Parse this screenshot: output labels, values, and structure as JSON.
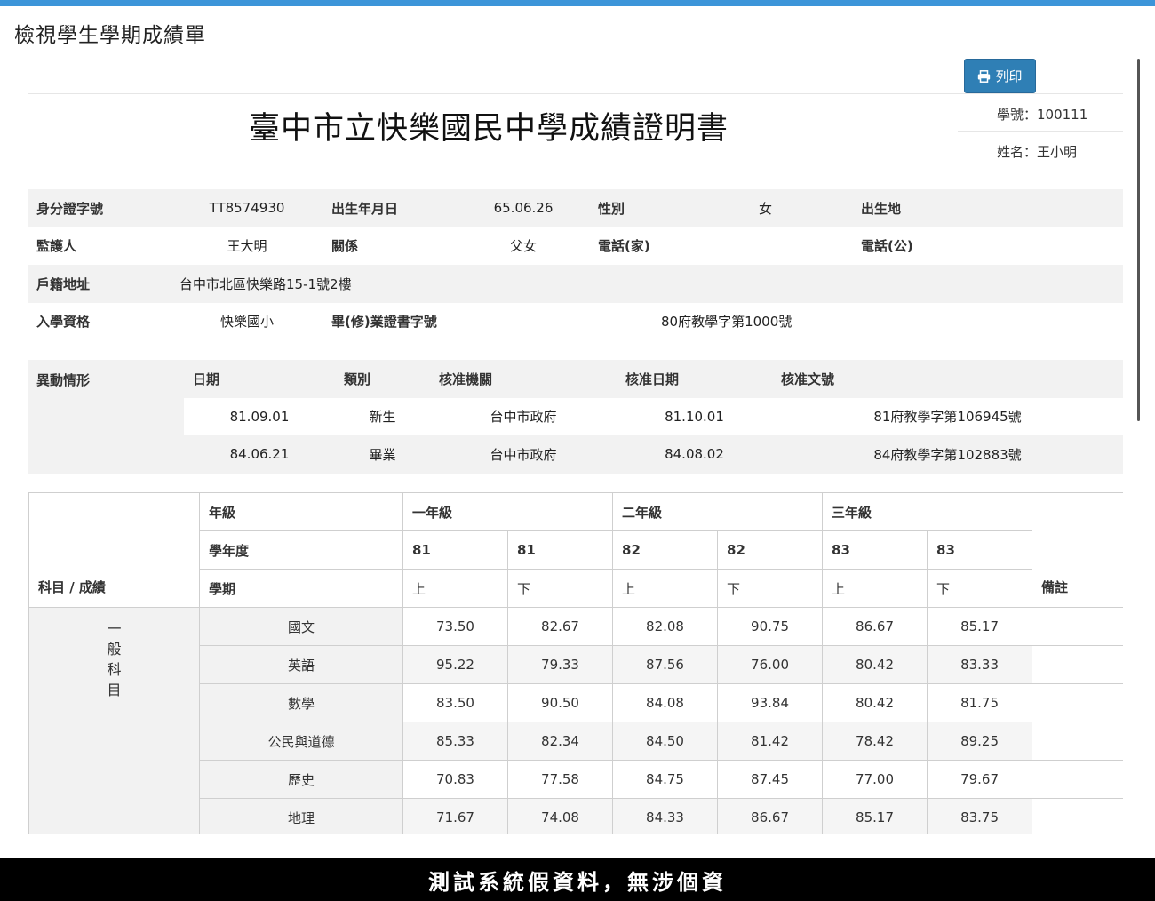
{
  "page": {
    "title": "檢視學生學期成績單"
  },
  "toolbar": {
    "print_label": "列印"
  },
  "certificate": {
    "title": "臺中市立快樂國民中學成績證明書",
    "student_id_label": "學號：100111",
    "name_label": "姓名：王小明"
  },
  "info": {
    "id_label": "身分證字號",
    "id_value": "TT8574930",
    "birth_label": "出生年月日",
    "birth_value": "65.06.26",
    "gender_label": "性別",
    "gender_value": "女",
    "birthplace_label": "出生地",
    "birthplace_value": "",
    "guardian_label": "監護人",
    "guardian_value": "王大明",
    "relation_label": "關係",
    "relation_value": "父女",
    "home_phone_label": "電話(家)",
    "home_phone_value": "",
    "office_phone_label": "電話(公)",
    "office_phone_value": "",
    "address_label": "戶籍地址",
    "address_value": "台中市北區快樂路15-1號2樓",
    "entry_label": "入學資格",
    "entry_value": "快樂國小",
    "cert_label": "畢(修)業證書字號",
    "cert_value": "80府教學字第1000號"
  },
  "changes": {
    "label": "異動情形",
    "headers": [
      "日期",
      "類別",
      "核准機關",
      "核准日期",
      "核准文號"
    ],
    "rows": [
      [
        "81.09.01",
        "新生",
        "台中市政府",
        "81.10.01",
        "81府教學字第106945號"
      ],
      [
        "84.06.21",
        "畢業",
        "台中市政府",
        "84.08.02",
        "84府教學字第102883號"
      ]
    ]
  },
  "grades": {
    "subject_header": "科目 / 成績",
    "grade_label": "年級",
    "year_label": "學年度",
    "semester_label": "學期",
    "note_label": "備註",
    "grades": [
      "一年級",
      "二年級",
      "三年級"
    ],
    "years": [
      "81",
      "81",
      "82",
      "82",
      "83",
      "83"
    ],
    "semesters": [
      "上",
      "下",
      "上",
      "下",
      "上",
      "下"
    ],
    "category": "一\n般\n科\n目",
    "subjects": [
      {
        "name": "國文",
        "scores": [
          "73.50",
          "82.67",
          "82.08",
          "90.75",
          "86.67",
          "85.17"
        ]
      },
      {
        "name": "英語",
        "scores": [
          "95.22",
          "79.33",
          "87.56",
          "76.00",
          "80.42",
          "83.33"
        ]
      },
      {
        "name": "數學",
        "scores": [
          "83.50",
          "90.50",
          "84.08",
          "93.84",
          "80.42",
          "81.75"
        ]
      },
      {
        "name": "公民與道德",
        "scores": [
          "85.33",
          "82.34",
          "84.50",
          "81.42",
          "78.42",
          "89.25"
        ]
      },
      {
        "name": "歷史",
        "scores": [
          "70.83",
          "77.58",
          "84.75",
          "87.45",
          "77.00",
          "79.67"
        ]
      },
      {
        "name": "地理",
        "scores": [
          "71.67",
          "74.08",
          "84.33",
          "86.67",
          "85.17",
          "83.75"
        ]
      }
    ]
  },
  "footer": {
    "disclaimer": "測試系統假資料，無涉個資"
  },
  "colors": {
    "accent": "#3c95d9",
    "button": "#2f7fb5",
    "stripe": "#f2f2f2"
  }
}
